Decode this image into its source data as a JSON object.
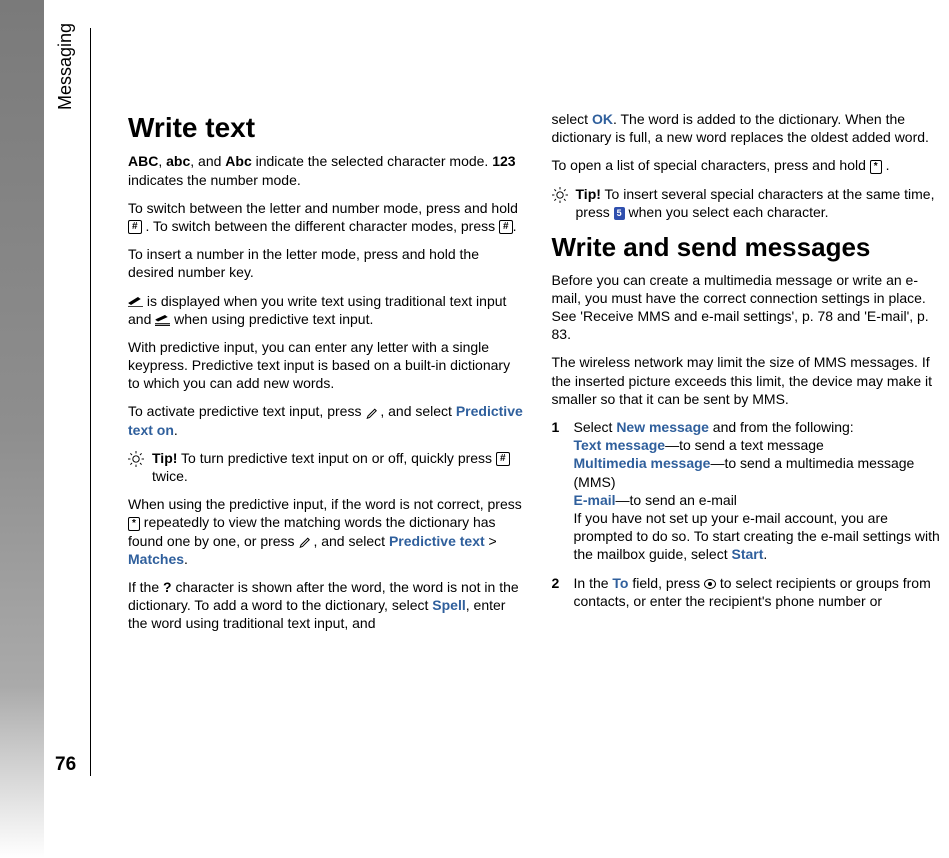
{
  "chapterLabel": "Messaging",
  "pageNumber": "76",
  "col1": {
    "heading": "Write text",
    "p1_bold_a": "ABC",
    "p1_after_a": ", ",
    "p1_bold_b": "abc",
    "p1_after_b": ", and ",
    "p1_bold_c": "Abc",
    "p1_after_c": " indicate the selected character mode. ",
    "p1_bold_d": "123",
    "p1_after_d": " indicates the number mode.",
    "p2_pre": "To switch between the letter and number mode, press and hold ",
    "p2_mid": ". To switch between the different character modes, press ",
    "p2_end": ".",
    "p3": "To insert a number in the letter mode, press and hold the desired number key.",
    "p4_pre": "",
    "p4_after_icon1": " is displayed when you write text using traditional text input and ",
    "p4_after_icon2": " when using predictive text input.",
    "p5": "With predictive input, you can enter any letter with a single keypress. Predictive text input is based on a built-in dictionary to which you can add new words.",
    "p6_pre": "To activate predictive text input, press ",
    "p6_mid": ", and select ",
    "p6_link": "Predictive text on",
    "p6_end": ".",
    "tip1_label": "Tip!",
    "tip1_text": " To turn predictive text input on or off, quickly press ",
    "tip1_mid": " twice.",
    "p7_pre": "When using the predictive input, if the word is not correct, press ",
    "p7_after_star": " repeatedly to view the matching words the dictionary has found one by one, or press ",
    "p7_after_pencil": ", and select ",
    "p7_link_a": "Predictive text",
    "p7_gt": " > ",
    "p7_link_b": "Matches",
    "p7_end": ".",
    "p8_pre": "If the ",
    "p8_q": "?",
    "p8_mid": " character is shown after the word, the word is not in the dictionary. To add a word to the dictionary, select ",
    "p8_link": "Spell",
    "p8_end": ", enter the word using traditional text input, and "
  },
  "col2": {
    "p9_pre": "select ",
    "p9_link": "OK",
    "p9_end": ". The word is added to the dictionary. When the dictionary is full, a new word replaces the oldest added word.",
    "p10_pre": "To open a list of special characters, press and hold ",
    "p10_end": ".",
    "tip2_label": "Tip!",
    "tip2_text": " To insert several special characters at the same time, press ",
    "tip2_end": " when you select each character.",
    "heading2": "Write and send messages",
    "p11": "Before you can create a multimedia message or write an e-mail, you must have the correct connection settings in place. See 'Receive MMS and e-mail settings', p. 78 and 'E-mail', p. 83.",
    "p12": "The wireless network may limit the size of MMS messages. If the inserted picture exceeds this limit, the device may make it smaller so that it can be sent by MMS.",
    "step1_num": "1",
    "step1_pre": "Select ",
    "step1_link_nm": "New message",
    "step1_after_nm": " and from the following:",
    "step1_link_tm": "Text message",
    "step1_after_tm": "—to send a text message",
    "step1_link_mm": "Multimedia message",
    "step1_after_mm": "—to send a multimedia message (MMS)",
    "step1_link_em": "E-mail",
    "step1_after_em": "—to send an e-mail",
    "step1_prompt": "If you have not set up your e-mail account, you are prompted to do so. To start creating the e-mail settings with the mailbox guide, select ",
    "step1_link_start": "Start",
    "step1_prompt_end": ".",
    "step2_num": "2",
    "step2_pre": "In the ",
    "step2_link_to": "To",
    "step2_mid": " field, press ",
    "step2_end": " to select recipients or groups from contacts, or enter the recipient's phone number or "
  }
}
